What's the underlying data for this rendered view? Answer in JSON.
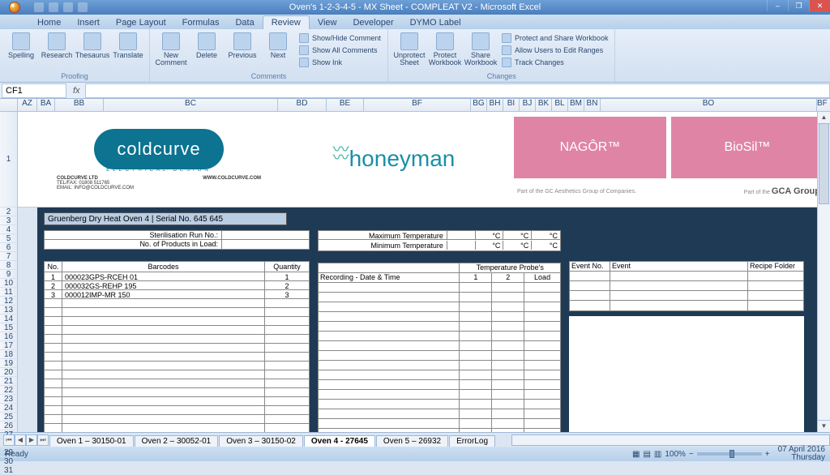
{
  "window": {
    "title": "Oven's 1-2-3-4-5 - MX Sheet - COMPLEAT V2 - Microsoft Excel"
  },
  "ribbon_tabs": [
    "Home",
    "Insert",
    "Page Layout",
    "Formulas",
    "Data",
    "Review",
    "View",
    "Developer",
    "DYMO Label"
  ],
  "active_tab": "Review",
  "ribbon": {
    "proofing": {
      "label": "Proofing",
      "spelling": "Spelling",
      "research": "Research",
      "thesaurus": "Thesaurus",
      "translate": "Translate"
    },
    "comments": {
      "label": "Comments",
      "new": "New\nComment",
      "delete": "Delete",
      "previous": "Previous",
      "next": "Next",
      "showhide": "Show/Hide Comment",
      "showall": "Show All Comments",
      "showink": "Show Ink"
    },
    "changes": {
      "label": "Changes",
      "unprotect": "Unprotect\nSheet",
      "protectwb": "Protect\nWorkbook",
      "sharewb": "Share\nWorkbook",
      "protectshare": "Protect and Share Workbook",
      "allowedit": "Allow Users to Edit Ranges",
      "track": "Track Changes"
    }
  },
  "namebox": "CF1",
  "fx_label": "fx",
  "columns": {
    "az": "AZ",
    "ba": "BA",
    "bb": "BB",
    "bc": "BC",
    "bd": "BD",
    "be": "BE",
    "bf": "BF",
    "bg": "BG",
    "bh": "BH",
    "bi": "BI",
    "bj": "BJ",
    "bk": "BK",
    "bl": "BL",
    "bm": "BM",
    "bn": "BN",
    "bo": "BO",
    "bf2": "BF"
  },
  "rows": [
    "1",
    "2",
    "3",
    "4",
    "5",
    "6",
    "7",
    "8",
    "9",
    "10",
    "11",
    "12",
    "13",
    "14",
    "15",
    "16",
    "17",
    "18",
    "19",
    "20",
    "21",
    "22",
    "23",
    "24",
    "25",
    "26",
    "27",
    "28",
    "29",
    "30",
    "31"
  ],
  "logo": {
    "cold_name": "coldcurve",
    "cold_sub": "ELECTRICAL DESIGN",
    "cold_co": "COLDCURVE LTD",
    "cold_web": "WWW.COLDCURVE.COM",
    "cold_tel": "TEL/FAX:  01808 511765",
    "cold_email": "EMAIL:   INFO@COLDCURVE.COM",
    "honeyman": "honeyman",
    "nagor": "NAGÔR™",
    "biosil": "BioSil™",
    "gca_left": "Part of the GC Aesthetics Group of Companies.",
    "gca_right": "Part of the",
    "gca_logo": "GCA Group"
  },
  "sheet": {
    "title": "Gruenberg Dry Heat Oven 4  |  Serial No. 645 645",
    "sterilisation": "Sterilisation Run No.:",
    "products": "No. of Products in Load:",
    "tbl_hdr": {
      "no": "No.",
      "barcodes": "Barcodes",
      "qty": "Quantity"
    },
    "rows": [
      {
        "no": "1",
        "bar": "000023GPS-RCEH 01",
        "qty": "1"
      },
      {
        "no": "2",
        "bar": "000032GS-REHP 195",
        "qty": "2"
      },
      {
        "no": "3",
        "bar": "000012IMP-MR 150",
        "qty": "3"
      }
    ],
    "max_temp": "Maximum Temperature",
    "min_temp": "Minimum Temperature",
    "degC": "°C",
    "temp_probes": "Temperature Probe's",
    "rec_dt": "Recording - Date & Time",
    "p1": "1",
    "p2": "2",
    "load": "Load",
    "ev_no": "Event No.",
    "event": "Event",
    "recipe": "Recipe Folder"
  },
  "sheet_tabs": [
    "Oven 1 – 30150-01",
    "Oven 2 – 30052-01",
    "Oven 3 – 30150-02",
    "Oven 4 - 27645",
    "Oven 5 – 26932",
    "ErrorLog"
  ],
  "active_sheet": "Oven 4 - 27645",
  "status": {
    "ready": "Ready",
    "zoom": "100%",
    "date": "07 April 2016",
    "day": "Thursday"
  }
}
